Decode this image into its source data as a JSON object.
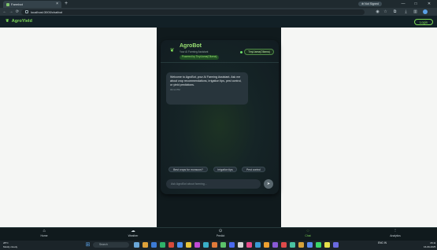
{
  "browser": {
    "tab_title": "Farmbot",
    "new_tab_symbol": "+",
    "tab_close_symbol": "×",
    "window_badge": "⊕ Not Signed",
    "url": "localhost:3000/chatbot",
    "nav": {
      "back": "←",
      "forward": "→",
      "reload": "⟳"
    },
    "window_controls": {
      "minimize": "—",
      "maximize": "□",
      "close": "✕"
    }
  },
  "app": {
    "brand": "AgroYield",
    "login_label": "Login"
  },
  "chat": {
    "title": "AgroBot",
    "subtitle": "Your AI Farming Assistant",
    "model_badge": "Powered by TinyLlama(Ollama)",
    "status": "TinyLlama(Ollama)",
    "welcome_message": "Welcome to AgroBot, your AI Farming Assistant. Ask me about crop recommendations, irrigation tips, pest control, or yield predictions.",
    "welcome_time": "03:11 PM",
    "chips": [
      "Best crops for monsoon?",
      "Irrigation tips",
      "Pest control"
    ],
    "input_placeholder": "Ask AgroBot about farming...",
    "send_symbol": "➤"
  },
  "bottom_nav": [
    {
      "label": "Home",
      "icon": "home-icon",
      "active": false
    },
    {
      "label": "Weather",
      "icon": "weather-icon",
      "active": false
    },
    {
      "label": "Predict",
      "icon": "predict-icon",
      "active": false
    },
    {
      "label": "Chat",
      "icon": "chat-icon",
      "active": true
    },
    {
      "label": "Analytics",
      "icon": "analytics-icon",
      "active": false
    }
  ],
  "taskbar": {
    "weather_temp": "28°C",
    "weather_desc": "Mostly cloudy",
    "search_placeholder": "Search",
    "tray_lang": "ENG IN",
    "time": "15:11",
    "date": "16-09-2025"
  },
  "colors": {
    "accent": "#7ed957",
    "panel": "#101a1d",
    "header": "#122026"
  }
}
